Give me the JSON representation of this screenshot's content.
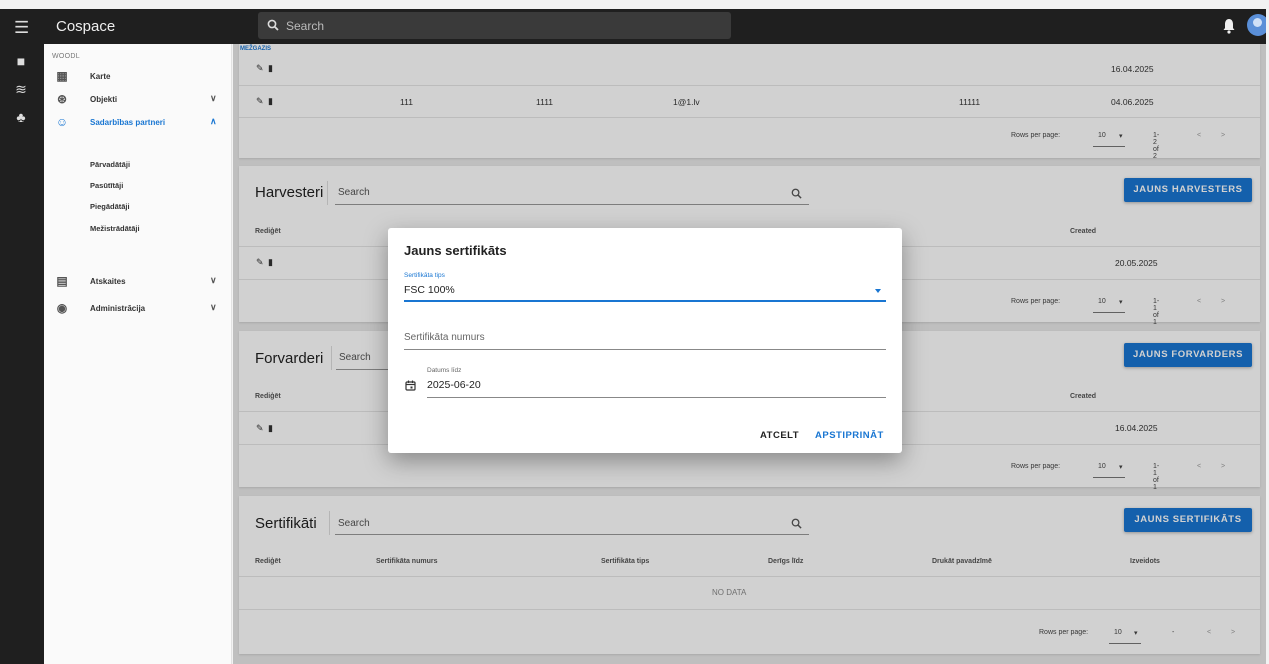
{
  "app": {
    "title": "Cospace",
    "search_placeholder": "Search"
  },
  "nav": {
    "org": "WOODL",
    "items": [
      {
        "label": "Karte"
      },
      {
        "label": "Objekti"
      },
      {
        "label": "Sadarbības partneri"
      },
      {
        "label": "Atskaites"
      },
      {
        "label": "Administrācija"
      }
    ],
    "sub_items": [
      "Pārvadātāji",
      "Pasūtītāji",
      "Piegādātāji",
      "Mežistrādātāji"
    ]
  },
  "top_table": {
    "header_partial": "MEŽGAZIS",
    "rows": [
      {
        "c1": "",
        "c2": "",
        "c3": "",
        "c4": "",
        "created": "16.04.2025"
      },
      {
        "c1": "111",
        "c2": "1111",
        "c3": "1@1.lv",
        "c4": "11111",
        "created": "04.06.2025"
      }
    ],
    "pagination": {
      "rows_per_page_label": "Rows per page:",
      "rows_per_page": "10",
      "range": "1-2 of 2"
    }
  },
  "harvesteri": {
    "title": "Harvesteri",
    "search_placeholder": "Search",
    "button": "JAUNS HARVESTERS",
    "col_edit": "Rediģēt",
    "col_created": "Created",
    "rows": [
      {
        "created": "20.05.2025"
      }
    ],
    "pagination": {
      "rows_per_page_label": "Rows per page:",
      "rows_per_page": "10",
      "range": "1-1 of 1"
    }
  },
  "forvarderi": {
    "title": "Forvarderi",
    "search_placeholder": "Search",
    "button": "JAUNS FORVARDERS",
    "col_edit": "Rediģēt",
    "col_created": "Created",
    "rows": [
      {
        "created": "16.04.2025"
      }
    ],
    "pagination": {
      "rows_per_page_label": "Rows per page:",
      "rows_per_page": "10",
      "range": "1-1 of 1"
    }
  },
  "sertifikati": {
    "title": "Sertifikāti",
    "search_placeholder": "Search",
    "button": "JAUNS SERTIFIKĀTS",
    "columns": [
      "Rediģēt",
      "Sertifikāta numurs",
      "Sertifikāta tips",
      "Derīgs līdz",
      "Drukāt pavadzīmē",
      "Izveidots"
    ],
    "empty": "NO DATA",
    "pagination": {
      "rows_per_page_label": "Rows per page:",
      "rows_per_page": "10",
      "range": "-"
    }
  },
  "dialog": {
    "title": "Jauns sertifikāts",
    "type_label": "Sertifikāta tips",
    "type_value": "FSC 100%",
    "number_placeholder": "Sertifikāta numurs",
    "date_label": "Datums līdz",
    "date_value": "2025-06-20",
    "cancel": "ATCELT",
    "confirm": "APSTIPRINĀT"
  },
  "colors": {
    "accent": "#1976d2",
    "appbar": "#1f1f1f"
  }
}
